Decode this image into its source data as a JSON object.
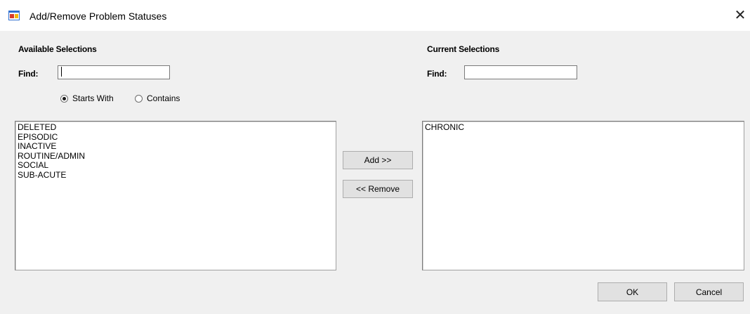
{
  "window": {
    "title": "Add/Remove Problem Statuses",
    "close_glyph": "✕"
  },
  "available": {
    "heading": "Available Selections",
    "find_label": "Find:",
    "find_value": "",
    "match_options": [
      {
        "label": "Starts With",
        "selected": true
      },
      {
        "label": "Contains",
        "selected": false
      }
    ],
    "items": [
      "DELETED",
      "EPISODIC",
      "INACTIVE",
      "ROUTINE/ADMIN",
      "SOCIAL",
      "SUB-ACUTE"
    ]
  },
  "current": {
    "heading": "Current Selections",
    "find_label": "Find:",
    "find_value": "",
    "items": [
      "CHRONIC"
    ]
  },
  "buttons": {
    "add": "Add >>",
    "remove": "<< Remove",
    "ok": "OK",
    "cancel": "Cancel"
  },
  "colors": {
    "background": "#f0f0f0",
    "titlebar": "#ffffff",
    "button_face": "#e1e1e1",
    "button_border": "#adadad"
  },
  "icons": {
    "app": "app-window-icon",
    "close": "close-icon"
  }
}
